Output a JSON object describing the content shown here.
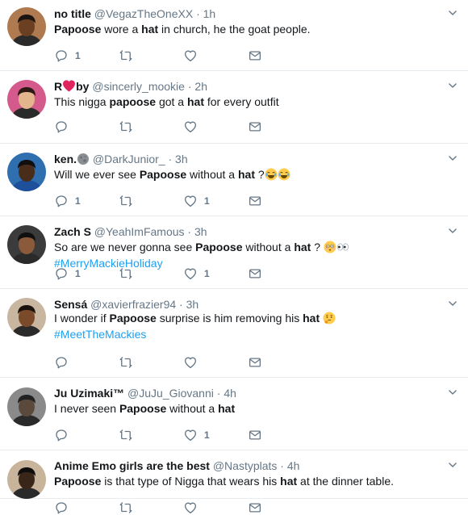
{
  "tweets": [
    {
      "name": "no title",
      "handle": "@VegazTheOneXX",
      "time": "1h",
      "segments": [
        [
          "b",
          "Papoose"
        ],
        [
          "t",
          " wore a "
        ],
        [
          "b",
          "hat"
        ],
        [
          "t",
          " in church, he the goat people."
        ]
      ],
      "reply_count": "1",
      "retweet_count": "",
      "like_count": ""
    },
    {
      "name": "R",
      "name_suffix": "by",
      "name_heart": true,
      "handle": "@sincerly_mookie",
      "time": "2h",
      "segments": [
        [
          "t",
          "This nigga "
        ],
        [
          "b",
          "papoose"
        ],
        [
          "t",
          " got a "
        ],
        [
          "b",
          "hat"
        ],
        [
          "t",
          " for every outfit"
        ]
      ],
      "reply_count": "",
      "retweet_count": "",
      "like_count": ""
    },
    {
      "name": "ken.",
      "name_moon": true,
      "handle": "@DarkJunior_",
      "time": "3h",
      "segments": [
        [
          "t",
          "Will we ever see "
        ],
        [
          "b",
          "Papoose"
        ],
        [
          "t",
          " without a "
        ],
        [
          "b",
          "hat"
        ],
        [
          "t",
          " ?"
        ],
        [
          "e",
          "joy"
        ],
        [
          "e",
          "joy"
        ]
      ],
      "reply_count": "1",
      "retweet_count": "",
      "like_count": "1"
    },
    {
      "name": "Zach S",
      "handle": "@YeahImFamous",
      "time": "3h",
      "segments": [
        [
          "t",
          "So are we never gonna see "
        ],
        [
          "b",
          "Papoose"
        ],
        [
          "t",
          " without a "
        ],
        [
          "b",
          "hat"
        ],
        [
          "t",
          " ? "
        ],
        [
          "e",
          "flushed"
        ],
        [
          "e",
          "eyes"
        ],
        [
          "t",
          " "
        ],
        [
          "h",
          "#MerryMackieHoliday"
        ]
      ],
      "reply_count": "1",
      "retweet_count": "",
      "like_count": "1"
    },
    {
      "name": "Sensá",
      "handle": "@xavierfrazier94",
      "time": "3h",
      "segments": [
        [
          "t",
          "I wonder if "
        ],
        [
          "b",
          "Papoose"
        ],
        [
          "t",
          " surprise is him removing his "
        ],
        [
          "b",
          "hat"
        ],
        [
          "t",
          " "
        ],
        [
          "e",
          "thinking"
        ],
        [
          "br",
          ""
        ],
        [
          "h",
          "#MeetTheMackies"
        ]
      ],
      "reply_count": "",
      "retweet_count": "",
      "like_count": ""
    },
    {
      "name": "Ju Uzimaki™",
      "handle": "@JuJu_Giovanni",
      "time": "4h",
      "segments": [
        [
          "t",
          "I never seen "
        ],
        [
          "b",
          "Papoose"
        ],
        [
          "t",
          " without a "
        ],
        [
          "b",
          "hat"
        ]
      ],
      "reply_count": "",
      "retweet_count": "",
      "like_count": "1"
    },
    {
      "name": "Anime Emo girls are the best",
      "handle": "@Nastyplats",
      "time": "4h",
      "segments": [
        [
          "b",
          "Papoose"
        ],
        [
          "t",
          " is that type of Nigga that wears his "
        ],
        [
          "b",
          "hat"
        ],
        [
          "t",
          " at the dinner table."
        ]
      ],
      "reply_count": "",
      "retweet_count": "",
      "like_count": ""
    }
  ],
  "separator": "·",
  "colors": {
    "name": "#14171a",
    "muted": "#657786",
    "hashtag": "#1da1f2",
    "heart_red": "#e0245e",
    "divider": "#e6ecf0"
  },
  "icons": [
    "reply-icon",
    "retweet-icon",
    "like-icon",
    "direct-message-icon",
    "caret-down-icon"
  ]
}
